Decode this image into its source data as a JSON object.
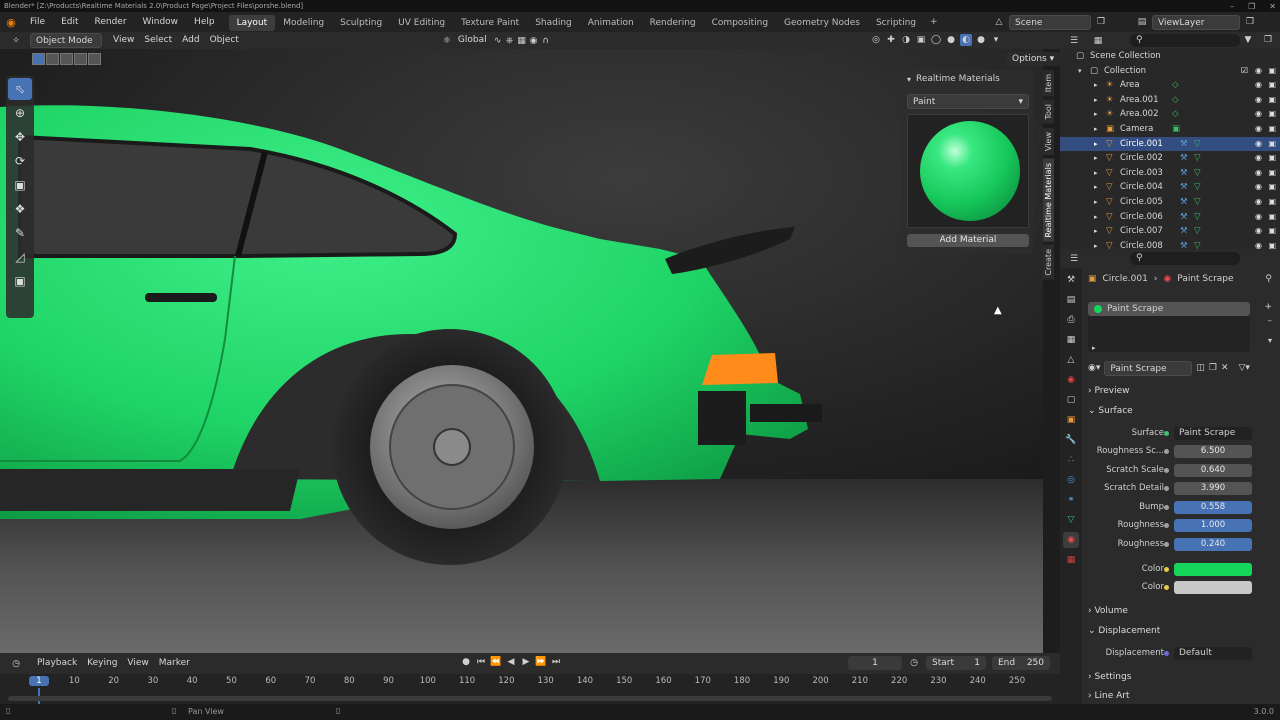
{
  "window": {
    "title": "Blender* [Z:\\Products\\Realtime Materials 2.0\\Product Page\\Project Files\\porshe.blend]"
  },
  "menu": [
    "File",
    "Edit",
    "Render",
    "Window",
    "Help"
  ],
  "workspaces": [
    "Layout",
    "Modeling",
    "Sculpting",
    "UV Editing",
    "Texture Paint",
    "Shading",
    "Animation",
    "Rendering",
    "Compositing",
    "Geometry Nodes",
    "Scripting"
  ],
  "scene": {
    "label": "Scene",
    "viewlayer": "ViewLayer"
  },
  "viewport_header": {
    "mode": "Object Mode",
    "view": "View",
    "select": "Select",
    "add": "Add",
    "object": "Object",
    "orientation": "Global",
    "options": "Options"
  },
  "npanel": {
    "title": "Realtime Materials",
    "dropdown": "Paint",
    "add_button": "Add Material"
  },
  "side_tabs": [
    "Item",
    "Tool",
    "View",
    "Realtime Materials",
    "Create"
  ],
  "outliner": {
    "scene_collection": "Scene Collection",
    "collection": "Collection",
    "items": [
      "Area",
      "Area.001",
      "Area.002",
      "Camera",
      "Circle.001",
      "Circle.002",
      "Circle.003",
      "Circle.004",
      "Circle.005",
      "Circle.006",
      "Circle.007",
      "Circle.008"
    ],
    "selected": "Circle.001"
  },
  "properties": {
    "breadcrumb_object": "Circle.001",
    "breadcrumb_material": "Paint Scrape",
    "slot": "Paint Scrape",
    "material_name": "Paint Scrape",
    "sections": {
      "preview": "Preview",
      "surface": "Surface",
      "volume": "Volume",
      "displacement": "Displacement",
      "settings": "Settings",
      "lineart": "Line Art"
    },
    "surface_label": "Surface",
    "surface_value": "Paint Scrape",
    "fields": [
      {
        "label": "Roughness Sc...",
        "value": "6.500",
        "blue": false
      },
      {
        "label": "Scratch Scale",
        "value": "0.640",
        "blue": false
      },
      {
        "label": "Scratch Detail",
        "value": "3.990",
        "blue": false
      },
      {
        "label": "Bump",
        "value": "0.558",
        "blue": true
      },
      {
        "label": "Roughness",
        "value": "1.000",
        "blue": true
      },
      {
        "label": "Roughness",
        "value": "0.240",
        "blue": true
      }
    ],
    "color1_label": "Color",
    "color1": "#14d65a",
    "color2_label": "Color",
    "color2": "#c8c8c8",
    "displacement_label": "Displacement",
    "displacement_value": "Default"
  },
  "timeline": {
    "playback": "Playback",
    "keying": "Keying",
    "view": "View",
    "marker": "Marker",
    "current": "1",
    "start_label": "Start",
    "start": "1",
    "end_label": "End",
    "end": "250",
    "ticks": [
      "1",
      "10",
      "20",
      "30",
      "40",
      "50",
      "60",
      "70",
      "80",
      "90",
      "100",
      "110",
      "120",
      "130",
      "140",
      "150",
      "160",
      "170",
      "180",
      "190",
      "200",
      "210",
      "220",
      "230",
      "240",
      "250"
    ]
  },
  "status": {
    "pan": "Pan View",
    "version": "3.0.0"
  },
  "colors": {
    "car": "#22e06a",
    "accent": "#4772b3"
  }
}
